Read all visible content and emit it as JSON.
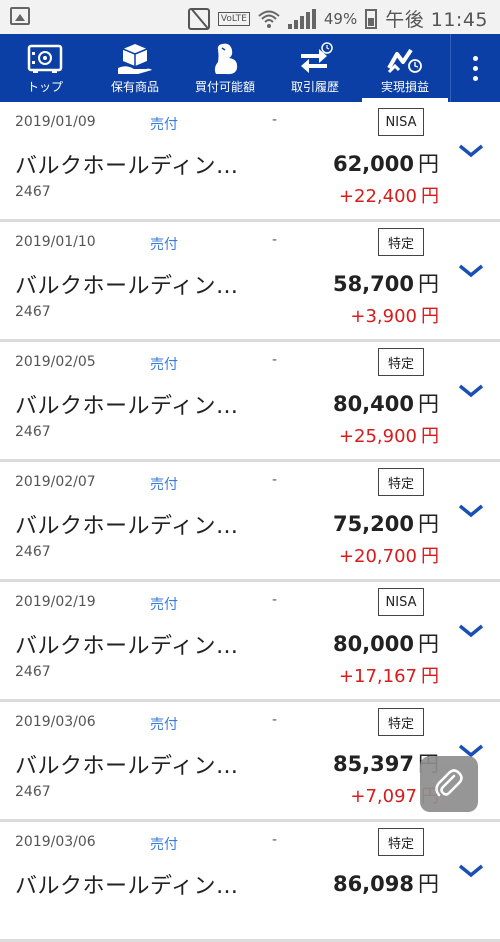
{
  "status_bar": {
    "battery_percent": "49%",
    "time": "午後 11:45",
    "volte": "VoLTE",
    "icons": [
      "gallery-icon",
      "mute-icon",
      "volte-icon",
      "wifi-icon",
      "signal-icon",
      "battery-icon"
    ]
  },
  "nav": {
    "items": [
      {
        "label": "トップ",
        "icon": "safe-icon"
      },
      {
        "label": "保有商品",
        "icon": "box-hand-icon"
      },
      {
        "label": "買付可能額",
        "icon": "arm-icon"
      },
      {
        "label": "取引履歴",
        "icon": "exchange-clock-icon"
      },
      {
        "label": "実現損益",
        "icon": "chart-clock-icon"
      }
    ],
    "active_index": 4,
    "more_icon": "more-vert-icon"
  },
  "trades": [
    {
      "date": "2019/01/09",
      "side": "売付",
      "dash": "-",
      "account": "NISA",
      "name": "バルクホールディン…",
      "code": "2467",
      "amount": "62,000",
      "pl": "+22,400",
      "unit": "円"
    },
    {
      "date": "2019/01/10",
      "side": "売付",
      "dash": "-",
      "account": "特定",
      "name": "バルクホールディン…",
      "code": "2467",
      "amount": "58,700",
      "pl": "+3,900",
      "unit": "円"
    },
    {
      "date": "2019/02/05",
      "side": "売付",
      "dash": "-",
      "account": "特定",
      "name": "バルクホールディン…",
      "code": "2467",
      "amount": "80,400",
      "pl": "+25,900",
      "unit": "円"
    },
    {
      "date": "2019/02/07",
      "side": "売付",
      "dash": "-",
      "account": "特定",
      "name": "バルクホールディン…",
      "code": "2467",
      "amount": "75,200",
      "pl": "+20,700",
      "unit": "円"
    },
    {
      "date": "2019/02/19",
      "side": "売付",
      "dash": "-",
      "account": "NISA",
      "name": "バルクホールディン…",
      "code": "2467",
      "amount": "80,000",
      "pl": "+17,167",
      "unit": "円"
    },
    {
      "date": "2019/03/06",
      "side": "売付",
      "dash": "-",
      "account": "特定",
      "name": "バルクホールディン…",
      "code": "2467",
      "amount": "85,397",
      "pl": "+7,097",
      "unit": "円"
    },
    {
      "date": "2019/03/06",
      "side": "売付",
      "dash": "-",
      "account": "特定",
      "name": "バルクホールディン…",
      "code": "2467",
      "amount": "86,098",
      "pl": "",
      "unit": "円"
    }
  ],
  "colors": {
    "nav_bg": "#0b3fa6",
    "side": "#3a7bd5",
    "profit": "#d81b1b",
    "chevron": "#1a4fb8"
  },
  "fab_icon": "paperclip-icon"
}
